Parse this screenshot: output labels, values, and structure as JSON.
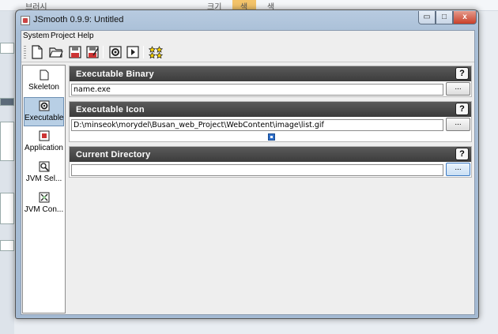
{
  "background": {
    "top_texts": [
      "브러시",
      "크기",
      "색",
      "색"
    ]
  },
  "window": {
    "title": "JSmooth 0.9.9: Untitled",
    "buttons": {
      "minimize": "▭",
      "maximize": "□",
      "close": "x"
    }
  },
  "menu": {
    "items": [
      "System",
      "Project",
      "Help"
    ]
  },
  "toolbar": {
    "tools": [
      "new-document-icon",
      "open-folder-icon",
      "save-icon",
      "save-as-icon",
      "compile-icon",
      "run-icon",
      "stars-icon"
    ]
  },
  "sidebar": {
    "items": [
      {
        "label": "Skeleton",
        "icon": "skeleton-icon",
        "selected": false
      },
      {
        "label": "Executable",
        "icon": "executable-icon",
        "selected": true
      },
      {
        "label": "Application",
        "icon": "application-icon",
        "selected": false
      },
      {
        "label": "JVM Sel...",
        "icon": "jvm-selection-icon",
        "selected": false
      },
      {
        "label": "JVM Con...",
        "icon": "jvm-configuration-icon",
        "selected": false
      }
    ]
  },
  "panels": {
    "binary": {
      "title": "Executable Binary",
      "value": "name.exe",
      "help": "?",
      "browse": "..."
    },
    "icon": {
      "title": "Executable Icon",
      "value": "D:\\minseok\\morydel\\Busan_web_Project\\WebContent\\image\\list.gif",
      "help": "?",
      "browse": "..."
    },
    "directory": {
      "title": "Current Directory",
      "value": "",
      "help": "?",
      "browse": "..."
    }
  },
  "colors": {
    "panel_header": "#3c3c3c",
    "selected_item": "#b8cfe5",
    "close_button": "#c9402a"
  }
}
